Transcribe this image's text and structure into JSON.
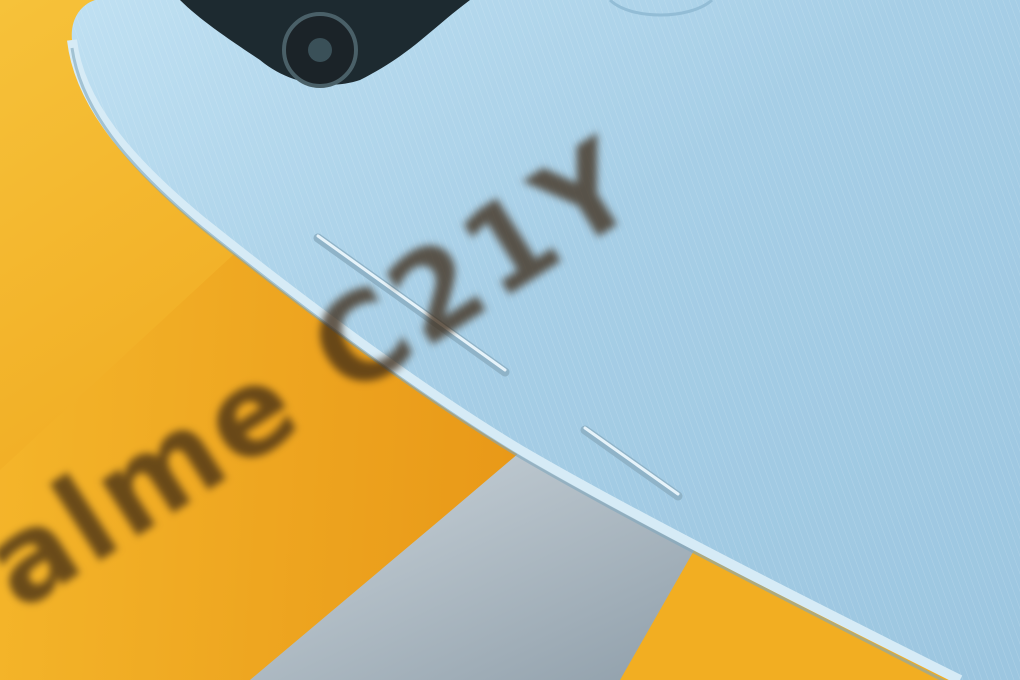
{
  "scene": {
    "box_print": "alme C21Y",
    "colors": {
      "box_yellow": "#f3b929",
      "box_dark_yellow": "#d98a10",
      "phone_blue": "#a9cfe6",
      "phone_frame": "#c9e3f2",
      "grey_surface": "#b8c6d0",
      "camera_black": "#1d2a30"
    }
  }
}
